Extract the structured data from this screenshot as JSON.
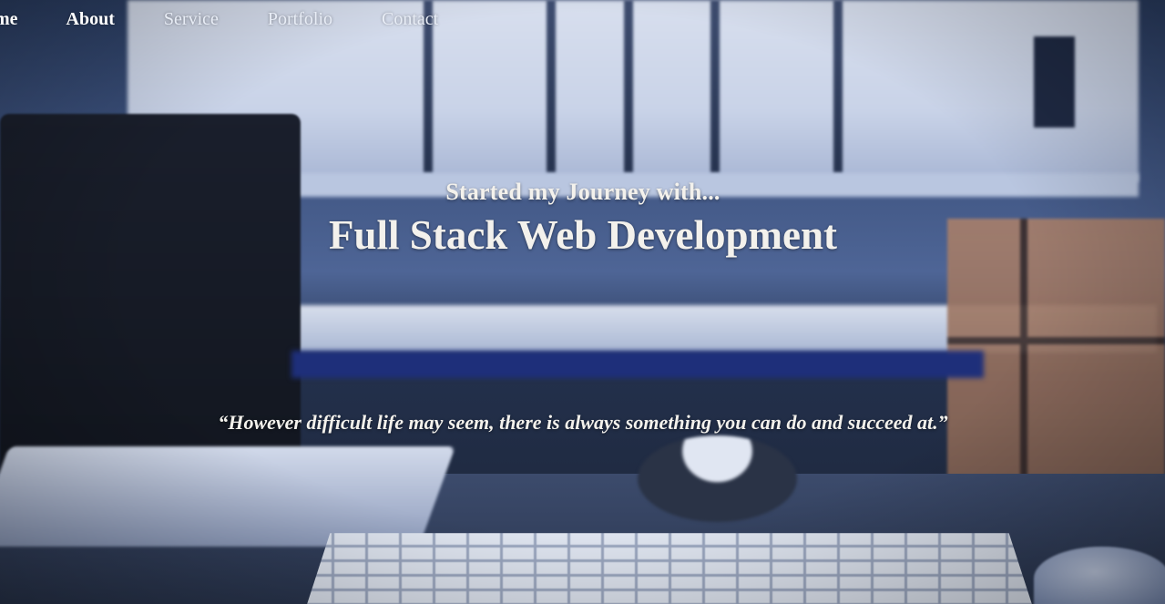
{
  "nav": {
    "items": [
      {
        "label": "me"
      },
      {
        "label": "About"
      },
      {
        "label": "Service"
      },
      {
        "label": "Portfolio"
      },
      {
        "label": "Contact"
      }
    ],
    "active_index": 1
  },
  "hero": {
    "subtitle": "Started my Journey with...",
    "title": "Full Stack Web Development",
    "quote": "“However difficult life may seem, there is always something you can do and succeed at.”"
  },
  "colors": {
    "text": "#f3f1ec",
    "nav_text": "#ffffff",
    "background_dark": "#1b2434",
    "background_blue": "#4e6596"
  }
}
